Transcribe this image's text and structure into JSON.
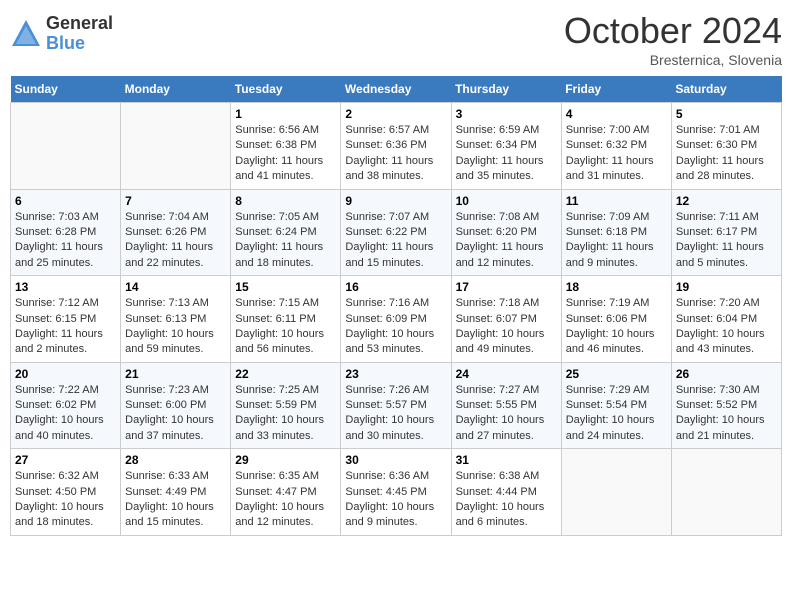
{
  "header": {
    "logo_general": "General",
    "logo_blue": "Blue",
    "month_title": "October 2024",
    "location": "Bresternica, Slovenia"
  },
  "days_of_week": [
    "Sunday",
    "Monday",
    "Tuesday",
    "Wednesday",
    "Thursday",
    "Friday",
    "Saturday"
  ],
  "weeks": [
    [
      {
        "num": "",
        "info": ""
      },
      {
        "num": "",
        "info": ""
      },
      {
        "num": "1",
        "info": "Sunrise: 6:56 AM\nSunset: 6:38 PM\nDaylight: 11 hours and 41 minutes."
      },
      {
        "num": "2",
        "info": "Sunrise: 6:57 AM\nSunset: 6:36 PM\nDaylight: 11 hours and 38 minutes."
      },
      {
        "num": "3",
        "info": "Sunrise: 6:59 AM\nSunset: 6:34 PM\nDaylight: 11 hours and 35 minutes."
      },
      {
        "num": "4",
        "info": "Sunrise: 7:00 AM\nSunset: 6:32 PM\nDaylight: 11 hours and 31 minutes."
      },
      {
        "num": "5",
        "info": "Sunrise: 7:01 AM\nSunset: 6:30 PM\nDaylight: 11 hours and 28 minutes."
      }
    ],
    [
      {
        "num": "6",
        "info": "Sunrise: 7:03 AM\nSunset: 6:28 PM\nDaylight: 11 hours and 25 minutes."
      },
      {
        "num": "7",
        "info": "Sunrise: 7:04 AM\nSunset: 6:26 PM\nDaylight: 11 hours and 22 minutes."
      },
      {
        "num": "8",
        "info": "Sunrise: 7:05 AM\nSunset: 6:24 PM\nDaylight: 11 hours and 18 minutes."
      },
      {
        "num": "9",
        "info": "Sunrise: 7:07 AM\nSunset: 6:22 PM\nDaylight: 11 hours and 15 minutes."
      },
      {
        "num": "10",
        "info": "Sunrise: 7:08 AM\nSunset: 6:20 PM\nDaylight: 11 hours and 12 minutes."
      },
      {
        "num": "11",
        "info": "Sunrise: 7:09 AM\nSunset: 6:18 PM\nDaylight: 11 hours and 9 minutes."
      },
      {
        "num": "12",
        "info": "Sunrise: 7:11 AM\nSunset: 6:17 PM\nDaylight: 11 hours and 5 minutes."
      }
    ],
    [
      {
        "num": "13",
        "info": "Sunrise: 7:12 AM\nSunset: 6:15 PM\nDaylight: 11 hours and 2 minutes."
      },
      {
        "num": "14",
        "info": "Sunrise: 7:13 AM\nSunset: 6:13 PM\nDaylight: 10 hours and 59 minutes."
      },
      {
        "num": "15",
        "info": "Sunrise: 7:15 AM\nSunset: 6:11 PM\nDaylight: 10 hours and 56 minutes."
      },
      {
        "num": "16",
        "info": "Sunrise: 7:16 AM\nSunset: 6:09 PM\nDaylight: 10 hours and 53 minutes."
      },
      {
        "num": "17",
        "info": "Sunrise: 7:18 AM\nSunset: 6:07 PM\nDaylight: 10 hours and 49 minutes."
      },
      {
        "num": "18",
        "info": "Sunrise: 7:19 AM\nSunset: 6:06 PM\nDaylight: 10 hours and 46 minutes."
      },
      {
        "num": "19",
        "info": "Sunrise: 7:20 AM\nSunset: 6:04 PM\nDaylight: 10 hours and 43 minutes."
      }
    ],
    [
      {
        "num": "20",
        "info": "Sunrise: 7:22 AM\nSunset: 6:02 PM\nDaylight: 10 hours and 40 minutes."
      },
      {
        "num": "21",
        "info": "Sunrise: 7:23 AM\nSunset: 6:00 PM\nDaylight: 10 hours and 37 minutes."
      },
      {
        "num": "22",
        "info": "Sunrise: 7:25 AM\nSunset: 5:59 PM\nDaylight: 10 hours and 33 minutes."
      },
      {
        "num": "23",
        "info": "Sunrise: 7:26 AM\nSunset: 5:57 PM\nDaylight: 10 hours and 30 minutes."
      },
      {
        "num": "24",
        "info": "Sunrise: 7:27 AM\nSunset: 5:55 PM\nDaylight: 10 hours and 27 minutes."
      },
      {
        "num": "25",
        "info": "Sunrise: 7:29 AM\nSunset: 5:54 PM\nDaylight: 10 hours and 24 minutes."
      },
      {
        "num": "26",
        "info": "Sunrise: 7:30 AM\nSunset: 5:52 PM\nDaylight: 10 hours and 21 minutes."
      }
    ],
    [
      {
        "num": "27",
        "info": "Sunrise: 6:32 AM\nSunset: 4:50 PM\nDaylight: 10 hours and 18 minutes."
      },
      {
        "num": "28",
        "info": "Sunrise: 6:33 AM\nSunset: 4:49 PM\nDaylight: 10 hours and 15 minutes."
      },
      {
        "num": "29",
        "info": "Sunrise: 6:35 AM\nSunset: 4:47 PM\nDaylight: 10 hours and 12 minutes."
      },
      {
        "num": "30",
        "info": "Sunrise: 6:36 AM\nSunset: 4:45 PM\nDaylight: 10 hours and 9 minutes."
      },
      {
        "num": "31",
        "info": "Sunrise: 6:38 AM\nSunset: 4:44 PM\nDaylight: 10 hours and 6 minutes."
      },
      {
        "num": "",
        "info": ""
      },
      {
        "num": "",
        "info": ""
      }
    ]
  ]
}
